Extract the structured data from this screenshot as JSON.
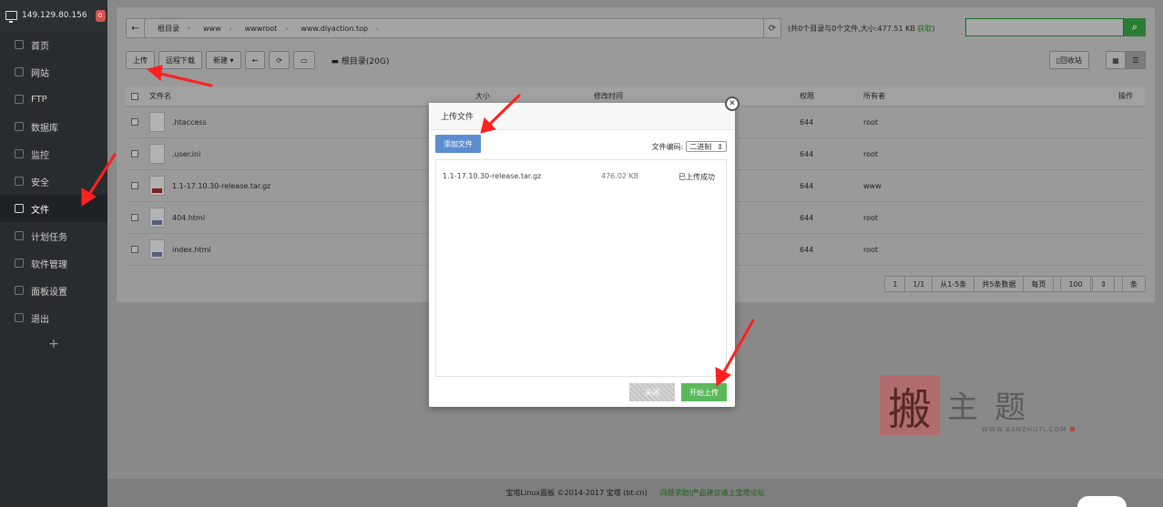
{
  "sidebar": {
    "server_ip": "149.129.80.156",
    "badge": "0",
    "items": [
      {
        "label": "首页",
        "icon": "home-icon"
      },
      {
        "label": "网站",
        "icon": "globe-icon"
      },
      {
        "label": "FTP",
        "icon": "ftp-icon"
      },
      {
        "label": "数据库",
        "icon": "database-icon"
      },
      {
        "label": "监控",
        "icon": "monitor-chart-icon"
      },
      {
        "label": "安全",
        "icon": "shield-icon"
      },
      {
        "label": "文件",
        "icon": "folder-icon",
        "active": true
      },
      {
        "label": "计划任务",
        "icon": "calendar-icon"
      },
      {
        "label": "软件管理",
        "icon": "apps-grid-icon"
      },
      {
        "label": "面板设置",
        "icon": "gear-icon"
      },
      {
        "label": "退出",
        "icon": "logout-icon"
      }
    ],
    "add": "+"
  },
  "breadcrumb": {
    "back": "←",
    "items": [
      "根目录",
      "www",
      "wwwroot",
      "www.diyaction.top"
    ],
    "refresh": "⟳"
  },
  "summary": {
    "text": "(共0个目录与0个文件,大小:477.51 KB",
    "link": "获取",
    "close": ")"
  },
  "toolbar": {
    "upload": "上传",
    "remote_download": "远程下载",
    "new": "新建 ▾",
    "back": "←",
    "refresh": "⟳",
    "terminal": "▭",
    "disk": "根目录(20G)",
    "recycle": "回收站"
  },
  "table": {
    "headers": [
      "文件名",
      "大小",
      "修改时间",
      "权限",
      "所有者",
      "操作"
    ],
    "rows": [
      {
        "name": ".htaccess",
        "perm": "644",
        "owner": "root",
        "type": "file"
      },
      {
        "name": ".user.ini",
        "perm": "644",
        "owner": "root",
        "type": "file"
      },
      {
        "name": "1.1-17.10.30-release.tar.gz",
        "perm": "644",
        "owner": "www",
        "type": "archive"
      },
      {
        "name": "404.html",
        "perm": "644",
        "owner": "root",
        "type": "html"
      },
      {
        "name": "index.html",
        "perm": "644",
        "owner": "root",
        "type": "html"
      }
    ]
  },
  "pager": {
    "page": "1",
    "pages": "1/1",
    "range": "从1-5条",
    "total": "共5条数据",
    "per_page_label": "每页",
    "per_page": "100",
    "unit": "条"
  },
  "dialog": {
    "title": "上传文件",
    "add_files": "添加文件",
    "encoding_label": "文件编码:",
    "encoding_value": "二进制",
    "file": {
      "name": "1.1-17.10.30-release.tar.gz",
      "size": "476.02 KB",
      "status": "已上传成功"
    },
    "cancel": "关闭",
    "start": "开始上传"
  },
  "footer": {
    "copyright": "宝塔Linux面板 ©2014-2017 宝塔 (bt.cn)",
    "link": "问题求助|产品建议请上宝塔论坛"
  },
  "watermark": {
    "seal": "搬",
    "text": "主题",
    "url": "WWW.BANZHUTI.COM"
  },
  "colors": {
    "sidebar_bg": "#282c2f",
    "primary_green": "#5cb85c",
    "add_button_blue": "#5a8ed0",
    "arrow_red": "#ff2020"
  }
}
